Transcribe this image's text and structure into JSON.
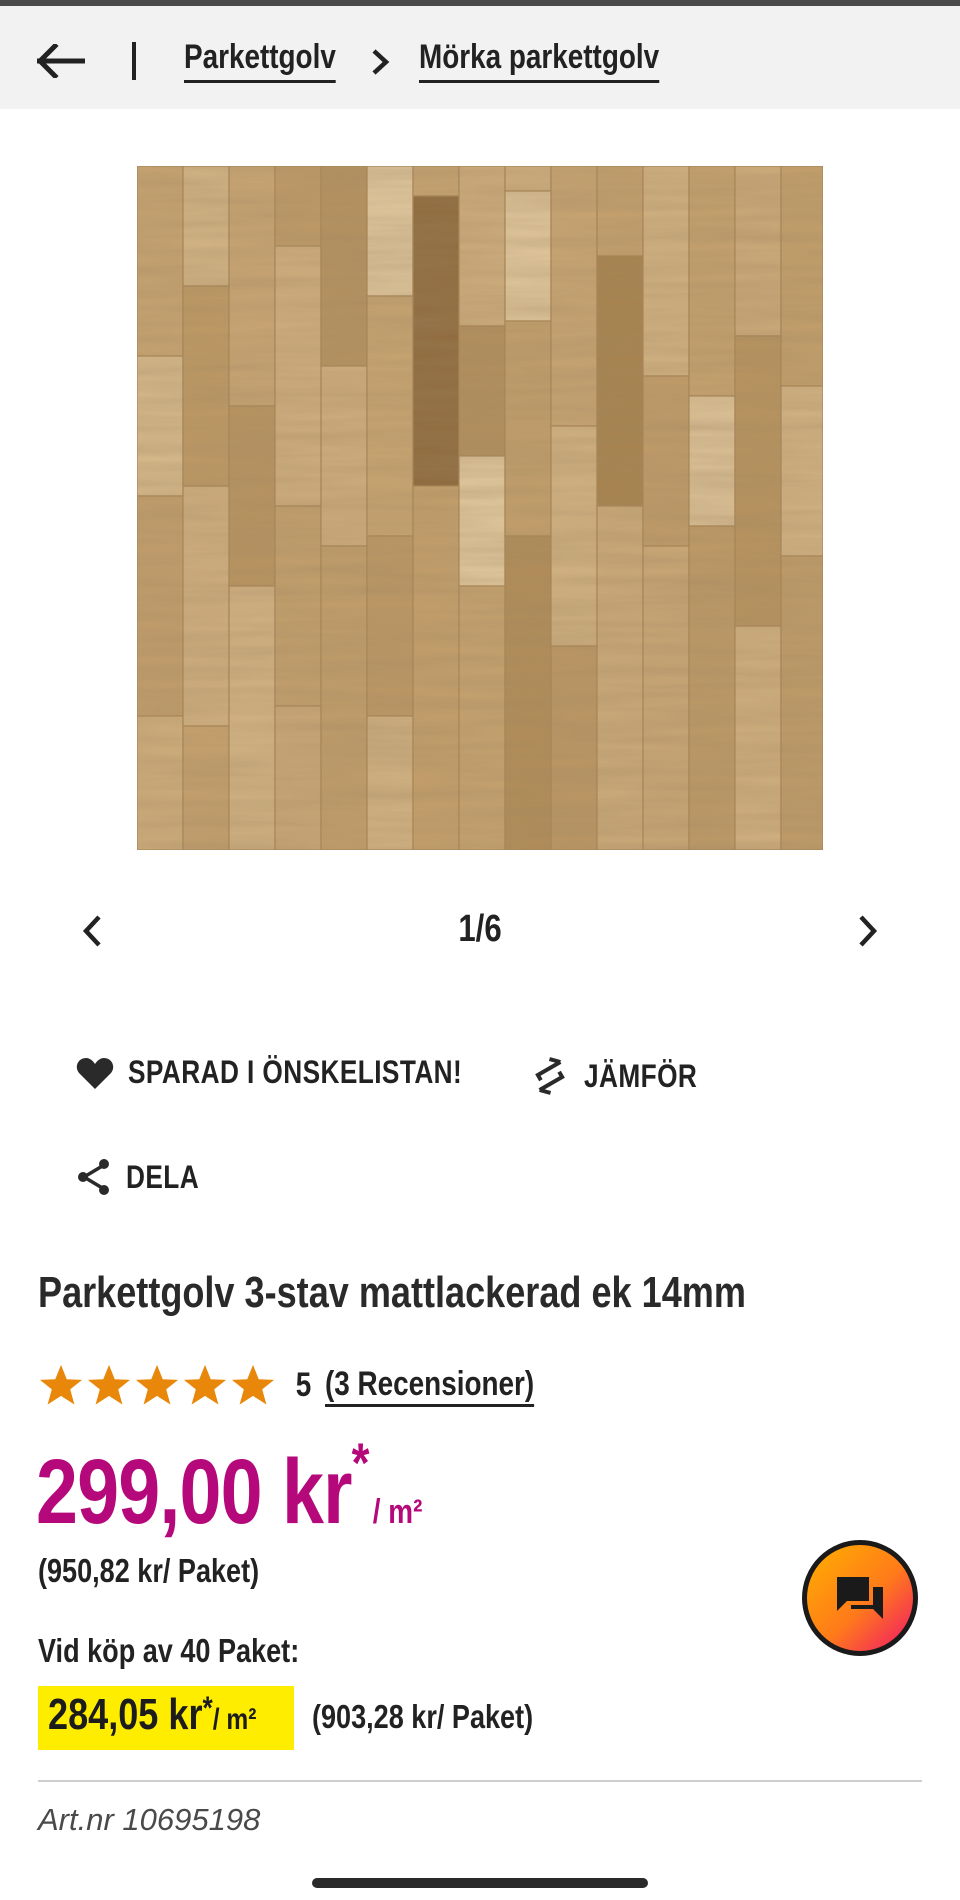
{
  "breadcrumb": {
    "items": [
      "Parkettgolv",
      "Mörka parkettgolv"
    ]
  },
  "gallery": {
    "counter": "1/6"
  },
  "actions": {
    "wishlist_label": "SPARAD I ÖNSKELISTAN!",
    "compare_label": "JÄMFÖR",
    "share_label": "DELA"
  },
  "product": {
    "title": "Parkettgolv 3-stav mattlackerad ek 14mm",
    "rating_value": "5",
    "rating_stars": 5,
    "reviews_label": "(3 Recensioner)",
    "price": "299,00 kr",
    "price_asterisk": "*",
    "price_unit": "/ m²",
    "package_price": "(950,82 kr/ Paket)",
    "volume_label": "Vid köp av 40 Paket:",
    "volume_price": "284,05 kr",
    "volume_asterisk": "*",
    "volume_unit": "/ m²",
    "volume_package_price": "(903,28 kr/ Paket)",
    "article_number": "Art.nr 10695198"
  },
  "colors": {
    "price": "#b5087a",
    "highlight": "#ffed00",
    "star": "#e8870a"
  }
}
